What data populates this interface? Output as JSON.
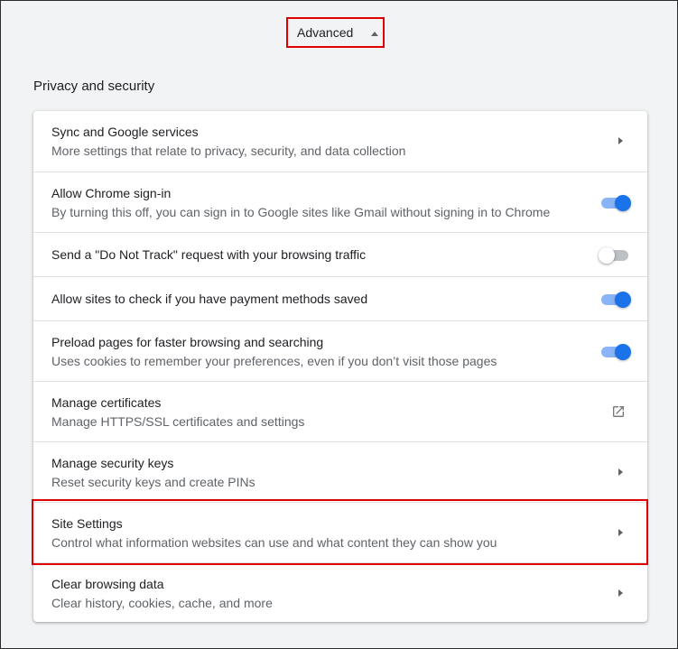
{
  "advanced": {
    "label": "Advanced",
    "icon": "arrow-up-icon"
  },
  "section": {
    "title": "Privacy and security"
  },
  "rows": [
    {
      "title": "Sync and Google services",
      "subtitle": "More settings that relate to privacy, security, and data collection",
      "control": "chevron-right-icon"
    },
    {
      "title": "Allow Chrome sign-in",
      "subtitle": "By turning this off, you can sign in to Google sites like Gmail without signing in to Chrome",
      "control": "toggle",
      "state": "on"
    },
    {
      "title": "Send a \"Do Not Track\" request with your browsing traffic",
      "control": "toggle",
      "state": "off"
    },
    {
      "title": "Allow sites to check if you have payment methods saved",
      "control": "toggle",
      "state": "on"
    },
    {
      "title": "Preload pages for faster browsing and searching",
      "subtitle": "Uses cookies to remember your preferences, even if you don’t visit those pages",
      "control": "toggle",
      "state": "on"
    },
    {
      "title": "Manage certificates",
      "subtitle": "Manage HTTPS/SSL certificates and settings",
      "control": "open-in-new-icon"
    },
    {
      "title": "Manage security keys",
      "subtitle": "Reset security keys and create PINs",
      "control": "chevron-right-icon"
    },
    {
      "title": "Site Settings",
      "subtitle": "Control what information websites can use and what content they can show you",
      "control": "chevron-right-icon",
      "highlighted": true
    },
    {
      "title": "Clear browsing data",
      "subtitle": "Clear history, cookies, cache, and more",
      "control": "chevron-right-icon"
    }
  ],
  "colors": {
    "highlight": "#e00000",
    "toggle_on": "#1a73e8",
    "toggle_on_track": "#8ab4f8",
    "toggle_off_track": "#bdc1c6"
  }
}
